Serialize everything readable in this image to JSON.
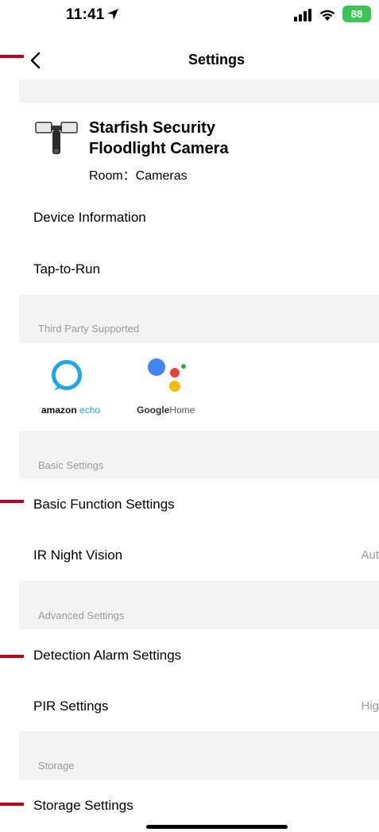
{
  "status_bar": {
    "time": "11:41",
    "battery": "88",
    "icons": [
      "location-arrow-icon",
      "signal-icon",
      "wifi-icon",
      "battery-icon"
    ]
  },
  "nav": {
    "title": "Settings",
    "back_icon": "chevron-left-icon"
  },
  "device": {
    "name_line1": "Starfish Security",
    "name_line2": "Floodlight Camera",
    "room": "Room：Cameras"
  },
  "rows": {
    "device_information": "Device Information",
    "tap_to_run": "Tap-to-Run"
  },
  "third_party": {
    "label": "Third Party Supported",
    "amazon_brand": "amazon",
    "amazon_product": " echo",
    "google_brand": "Google",
    "google_product": "Home"
  },
  "basic_settings": {
    "label": "Basic Settings",
    "basic_function": "Basic Function Settings",
    "ir_night_vision": "IR Night Vision",
    "ir_night_vision_value": "Aut"
  },
  "advanced_settings": {
    "label": "Advanced Settings",
    "detection_alarm": "Detection Alarm Settings",
    "pir": "PIR Settings",
    "pir_value": "Hig"
  },
  "storage": {
    "label": "Storage",
    "storage_settings": "Storage Settings"
  },
  "colors": {
    "marker": "#c0001a",
    "section_bg": "#f3f3f3",
    "battery": "#3cc552",
    "alexa": "#1ea7e8",
    "google_blue": "#4285f4",
    "google_red": "#ea4335",
    "google_yellow": "#fbbc05",
    "google_green": "#34a853"
  }
}
